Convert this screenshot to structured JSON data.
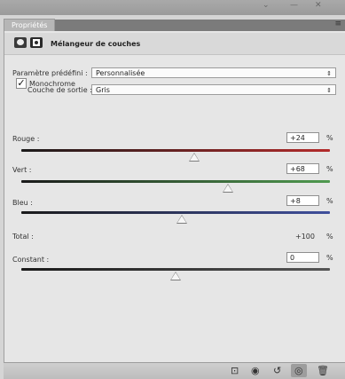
{
  "panel": {
    "tab_label": "Propriétés",
    "title": "Mélangeur de couches"
  },
  "preset": {
    "label": "Paramètre prédéfini :",
    "value": "Personnalisée"
  },
  "output_channel": {
    "label": "Couche de sortie :",
    "value": "Gris"
  },
  "monochrome": {
    "label": "Monochrome",
    "checked": true
  },
  "sliders": {
    "red": {
      "label": "Rouge :",
      "value": "+24",
      "unit": "%",
      "level": 0.56,
      "track_color": "#b32b2b"
    },
    "green": {
      "label": "Vert :",
      "value": "+68",
      "unit": "%",
      "level": 0.67,
      "track_color": "#4f9a4f"
    },
    "blue": {
      "label": "Bleu :",
      "value": "+8",
      "unit": "%",
      "level": 0.52,
      "track_color": "#3f4f9c"
    },
    "constant": {
      "label": "Constant :",
      "value": "0",
      "unit": "%",
      "level": 0.5,
      "track_color": "#555555"
    }
  },
  "total": {
    "label": "Total :",
    "value": "+100",
    "unit": "%"
  },
  "bottom_icons": [
    "clip-to-layer-icon",
    "eye-icon",
    "reset-icon",
    "visibility-icon",
    "trash-icon"
  ]
}
